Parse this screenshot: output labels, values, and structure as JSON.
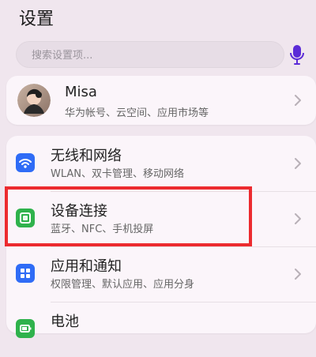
{
  "header": {
    "title": "设置"
  },
  "search": {
    "placeholder": "搜索设置项..."
  },
  "profile": {
    "name": "Misa",
    "subtitle": "华为帐号、云空间、应用市场等"
  },
  "settings": {
    "items": [
      {
        "title": "无线和网络",
        "subtitle": "WLAN、双卡管理、移动网络",
        "icon": "wifi-icon",
        "color": "#2f6cf6"
      },
      {
        "title": "设备连接",
        "subtitle": "蓝牙、NFC、手机投屏",
        "icon": "device-connection-icon",
        "color": "#2fb24c"
      },
      {
        "title": "应用和通知",
        "subtitle": "权限管理、默认应用、应用分身",
        "icon": "apps-notifications-icon",
        "color": "#2f6cf6"
      },
      {
        "title": "电池",
        "subtitle": "",
        "icon": "battery-icon",
        "color": "#2fb24c"
      }
    ]
  },
  "colors": {
    "highlight": "#ec2b2f",
    "mic": "#5b2bd7"
  }
}
